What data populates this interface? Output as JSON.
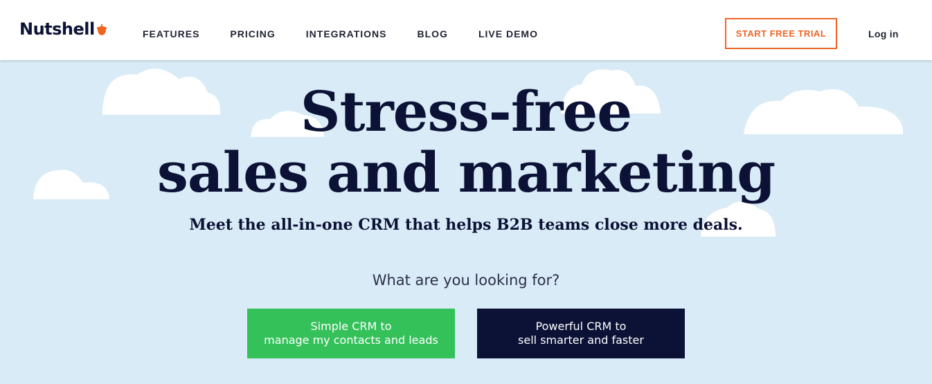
{
  "brand": {
    "name": "Nutshell",
    "accent_color": "#f06322",
    "navy_color": "#0c1236"
  },
  "nav": {
    "links": [
      "FEATURES",
      "PRICING",
      "INTEGRATIONS",
      "BLOG",
      "LIVE DEMO"
    ],
    "trial_label": "START FREE TRIAL",
    "login_label": "Log in"
  },
  "hero": {
    "title_line1": "Stress-free",
    "title_line2": "sales and marketing",
    "subtitle": "Meet the all-in-one CRM that helps B2B teams close more deals.",
    "question": "What are you looking for?",
    "cta_simple": {
      "line1": "Simple CRM to",
      "line2": "manage my contacts and leads",
      "color": "#34c15a"
    },
    "cta_powerful": {
      "line1": "Powerful CRM to",
      "line2": "sell smarter and faster",
      "color": "#0c1236"
    }
  }
}
